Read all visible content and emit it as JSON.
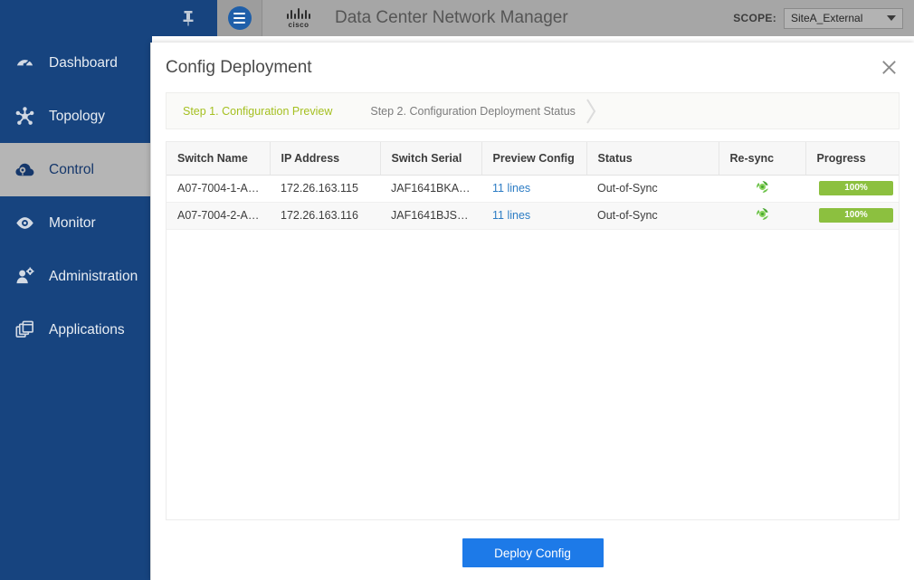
{
  "topbar": {
    "pin_icon": "pushpin-icon",
    "menu_icon": "hamburger-menu-icon",
    "brand": "cisco",
    "app_title": "Data Center Network Manager",
    "scope_label": "SCOPE:",
    "scope_value": "SiteA_External",
    "scope_caret_icon": "chevron-down-icon"
  },
  "sidebar": {
    "items": [
      {
        "label": "Dashboard",
        "icon": "gauge-icon",
        "active": false
      },
      {
        "label": "Topology",
        "icon": "network-topology-icon",
        "active": false
      },
      {
        "label": "Control",
        "icon": "cloud-control-icon",
        "active": true
      },
      {
        "label": "Monitor",
        "icon": "eye-icon",
        "active": false
      },
      {
        "label": "Administration",
        "icon": "user-gear-icon",
        "active": false
      },
      {
        "label": "Applications",
        "icon": "stacked-windows-icon",
        "active": false
      }
    ]
  },
  "dialog": {
    "title": "Config Deployment",
    "close_icon": "close-icon",
    "steps": [
      {
        "label": "Step 1. Configuration Preview",
        "active": true
      },
      {
        "label": "Step 2. Configuration Deployment Status",
        "active": false
      }
    ],
    "step_chevron_icon": "chevron-right-icon",
    "table": {
      "columns": [
        "Switch Name",
        "IP Address",
        "Switch Serial",
        "Preview Config",
        "Status",
        "Re-sync",
        "Progress"
      ],
      "rows": [
        {
          "switch_name": "A07-7004-1-A…",
          "ip_address": "172.26.163.115",
          "switch_serial": "JAF1641BKA…",
          "preview_config": "11 lines",
          "status": "Out-of-Sync",
          "resync_icon": "resync-refresh-icon",
          "progress": "100%"
        },
        {
          "switch_name": "A07-7004-2-A…",
          "ip_address": "172.26.163.116",
          "switch_serial": "JAF1641BJS…",
          "preview_config": "11 lines",
          "status": "Out-of-Sync",
          "resync_icon": "resync-refresh-icon",
          "progress": "100%"
        }
      ]
    },
    "deploy_button": "Deploy Config"
  },
  "colors": {
    "sidebar_blue": "#17447f",
    "topbar_gray": "#a6a6a6",
    "active_nav_gray": "#b5b5b5",
    "step_active_green": "#a5c021",
    "link_blue": "#2c7cc4",
    "progress_green": "#8cc03f",
    "deploy_blue": "#1d7ae8"
  }
}
